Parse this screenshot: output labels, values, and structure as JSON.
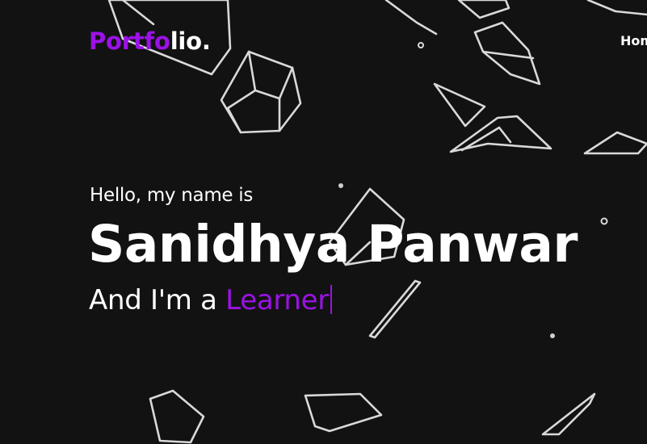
{
  "brand": {
    "logo_accent": "Portfo",
    "logo_rest": "lio."
  },
  "nav": {
    "items": [
      {
        "label": "Home"
      }
    ]
  },
  "hero": {
    "greeting": "Hello, my name is",
    "name": "Sanidhya Panwar",
    "role_prefix": "And I'm a ",
    "role_word": "Learner"
  },
  "colors": {
    "background": "#121212",
    "accent": "#9b12e6",
    "text": "#ffffff",
    "shape_stroke": "#d9d9d9"
  },
  "icons": {
    "typing_cursor": "typing-cursor-icon"
  }
}
